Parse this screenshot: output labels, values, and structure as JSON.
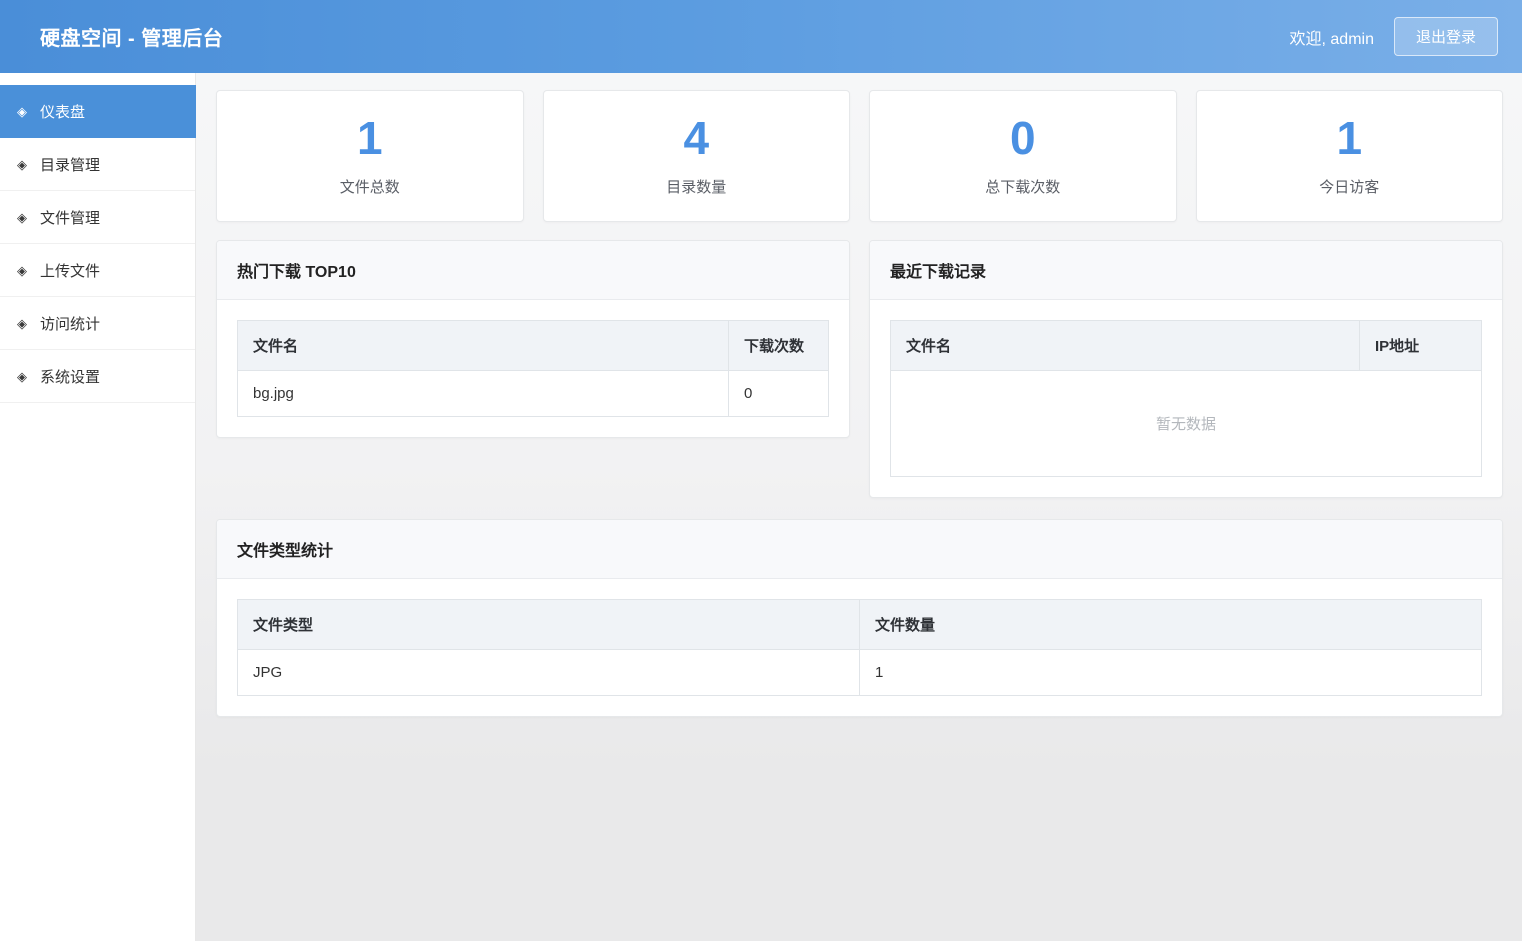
{
  "header": {
    "title": "硬盘空间 - 管理后台",
    "welcome": "欢迎, admin",
    "logout_label": "退出登录"
  },
  "sidebar": {
    "item_icon": "◈",
    "items": [
      {
        "label": "仪表盘",
        "active": true
      },
      {
        "label": "目录管理",
        "active": false
      },
      {
        "label": "文件管理",
        "active": false
      },
      {
        "label": "上传文件",
        "active": false
      },
      {
        "label": "访问统计",
        "active": false
      },
      {
        "label": "系统设置",
        "active": false
      }
    ]
  },
  "stats": [
    {
      "value": "1",
      "label": "文件总数"
    },
    {
      "value": "4",
      "label": "目录数量"
    },
    {
      "value": "0",
      "label": "总下载次数"
    },
    {
      "value": "1",
      "label": "今日访客"
    }
  ],
  "panels": {
    "top_downloads": {
      "title": "热门下载 TOP10",
      "columns": [
        "文件名",
        "下载次数"
      ],
      "rows": [
        [
          "bg.jpg",
          "0"
        ]
      ]
    },
    "recent_downloads": {
      "title": "最近下载记录",
      "columns": [
        "文件名",
        "IP地址"
      ],
      "empty_text": "暂无数据"
    },
    "file_types": {
      "title": "文件类型统计",
      "columns": [
        "文件类型",
        "文件数量"
      ],
      "rows": [
        [
          "JPG",
          "1"
        ]
      ]
    }
  },
  "colors": {
    "header_gradient_start": "#4a8ed8",
    "header_gradient_end": "#7aafe8",
    "sidebar_active": "#4a90d9",
    "stat_number": "#4a90e2",
    "table_header_bg": "#f0f3f7"
  }
}
